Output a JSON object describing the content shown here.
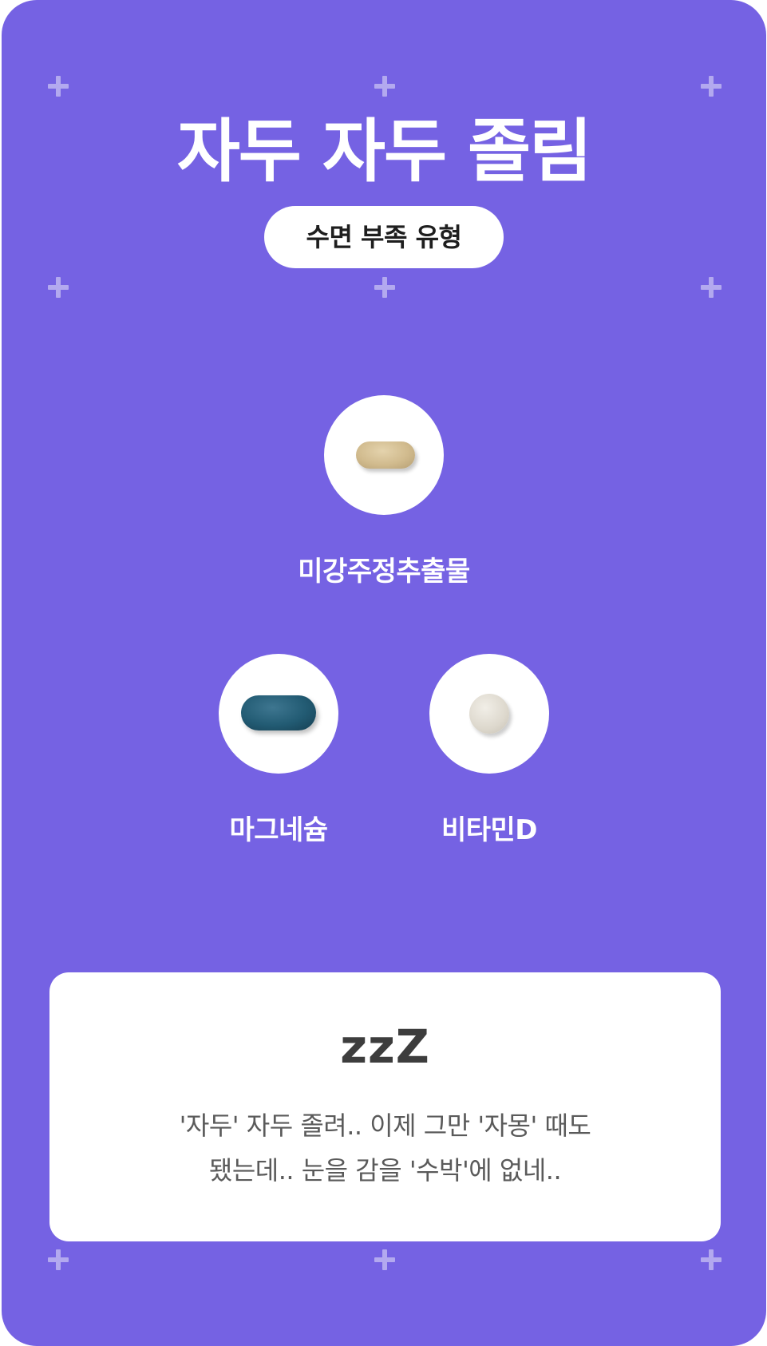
{
  "header": {
    "title": "자두 자두 졸림",
    "type_badge": "수면 부족 유형"
  },
  "ingredients": [
    {
      "name": "미강주정추출물",
      "pill": "capsule-pill-icon"
    },
    {
      "name": "마그네슘",
      "pill": "oval-tablet-icon"
    },
    {
      "name": "비타민D",
      "pill": "round-tablet-icon"
    }
  ],
  "message": {
    "heading": "zzZ",
    "line1": "'자두' 자두 졸려.. 이제 그만 '자몽' 때도",
    "line2": "됐는데.. 눈을 감을 '수박'에 없네.."
  },
  "colors": {
    "background": "#7562e3",
    "card": "#ffffff",
    "heading_text": "#3d3d3d",
    "body_text": "#5a5a5a"
  }
}
